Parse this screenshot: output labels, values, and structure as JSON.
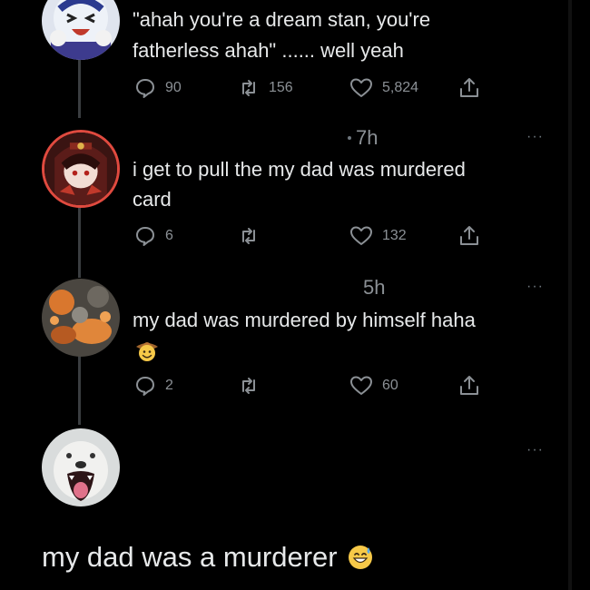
{
  "tweets": [
    {
      "text_line1": "\"ahah you're a dream stan, you're",
      "text_line2": "fatherless ahah\" ...... well yeah",
      "reply_count": "90",
      "retweet_count": "156",
      "like_count": "5,824",
      "avatar_icon": "cartoon-laughing-avatar"
    },
    {
      "timestamp": "7h",
      "more": "···",
      "text_line1": "i get to pull the my dad was murdered",
      "text_line2": "card",
      "reply_count": "6",
      "retweet_count": "",
      "like_count": "132",
      "avatar_icon": "anime-character-avatar"
    },
    {
      "timestamp": "5h",
      "more": "···",
      "text_line1": "my dad was murdered by himself haha",
      "emoji": "cowboy-face-emoji",
      "reply_count": "2",
      "retweet_count": "",
      "like_count": "60",
      "avatar_icon": "abstract-orange-avatar"
    },
    {
      "more": "···",
      "avatar_icon": "screaming-dog-avatar"
    }
  ],
  "caption": {
    "text": "my dad was a murderer",
    "emoji": "sweat-smile-emoji"
  },
  "colors": {
    "background": "#000000",
    "text": "#e7e9ea",
    "muted": "#8b9095",
    "rail": "#3a3d40"
  }
}
